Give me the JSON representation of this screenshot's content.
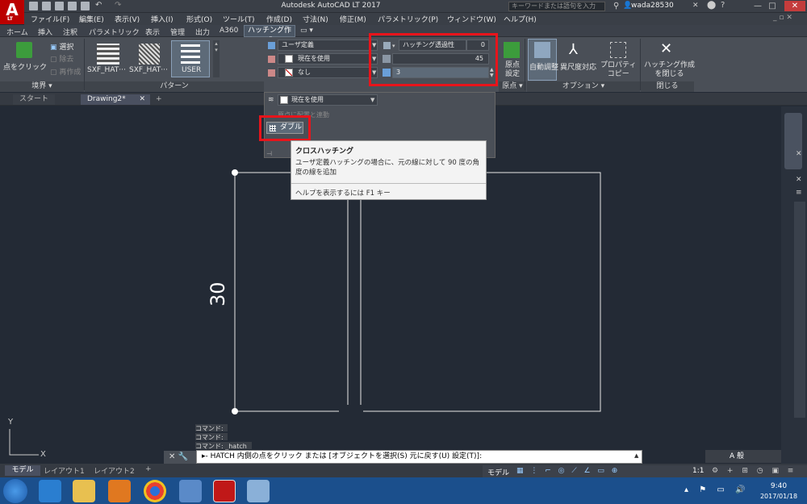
{
  "window": {
    "title": "Autodesk AutoCAD LT 2017",
    "search_placeholder": "キーワードまたは語句を入力",
    "user": "wada28530",
    "logo": "A",
    "logo_sub": "LT"
  },
  "menu": [
    "ファイル(F)",
    "編集(E)",
    "表示(V)",
    "挿入(I)",
    "形式(O)",
    "ツール(T)",
    "作成(D)",
    "寸法(N)",
    "修正(M)",
    "パラメトリック(P)",
    "ウィンドウ(W)",
    "ヘルプ(H)"
  ],
  "ribbon_tabs": [
    "ホーム",
    "挿入",
    "注釈",
    "パラメトリック",
    "表示",
    "管理",
    "出力",
    "A360"
  ],
  "active_tab": "ハッチング作成",
  "boundary": {
    "pick_label": "点をクリック",
    "select": "選択",
    "remove": "除去",
    "recreate": "再作成",
    "panel_title": "境界 ▾"
  },
  "pattern": {
    "items": [
      "SXF_HAT···",
      "SXF_HAT···",
      "USER"
    ],
    "panel_title": "パターン"
  },
  "properties": {
    "type": "ユーザ定義",
    "color": "現在を使用",
    "background": "なし",
    "transparency_label": "ハッチング透過性",
    "transparency_value": "0",
    "angle_value": "45",
    "spacing_value": "3"
  },
  "origin": {
    "label": "原点\n設定",
    "panel_title": "原点 ▾"
  },
  "options": {
    "auto": "自動調整",
    "annotative": "異尺度対応",
    "match": "プロパティ\nコピー",
    "panel_title": "オプション ▾"
  },
  "close": {
    "label": "ハッチング作成\nを閉じる",
    "panel_title": "閉じる"
  },
  "expanded": {
    "layer": "現在を使用",
    "hidden": "原点に配置と連動",
    "double": "ダブル"
  },
  "tooltip": {
    "title": "クロスハッチング",
    "body": "ユーザ定義ハッチングの場合に、元の線に対して 90 度の角度の線を追加",
    "help": "ヘルプを表示するには F1 キー"
  },
  "doc_tabs": [
    "スタート",
    "Drawing2*"
  ],
  "drawing": {
    "dimension": "30"
  },
  "command": {
    "history": [
      "コマンド:",
      "コマンド:",
      "コマンド: _hatch"
    ],
    "prompt": "▸- HATCH 内側の点をクリック または [オブジェクトを選択(S) 元に戻す(U) 設定(T)]:"
  },
  "layout_tabs": [
    "モデル",
    "レイアウト1",
    "レイアウト2"
  ],
  "status": {
    "model": "モデル",
    "scale": "1:1"
  },
  "clock": {
    "time": "9:40",
    "date": "2017/01/18"
  },
  "tray": {
    "ime": "A 般"
  }
}
